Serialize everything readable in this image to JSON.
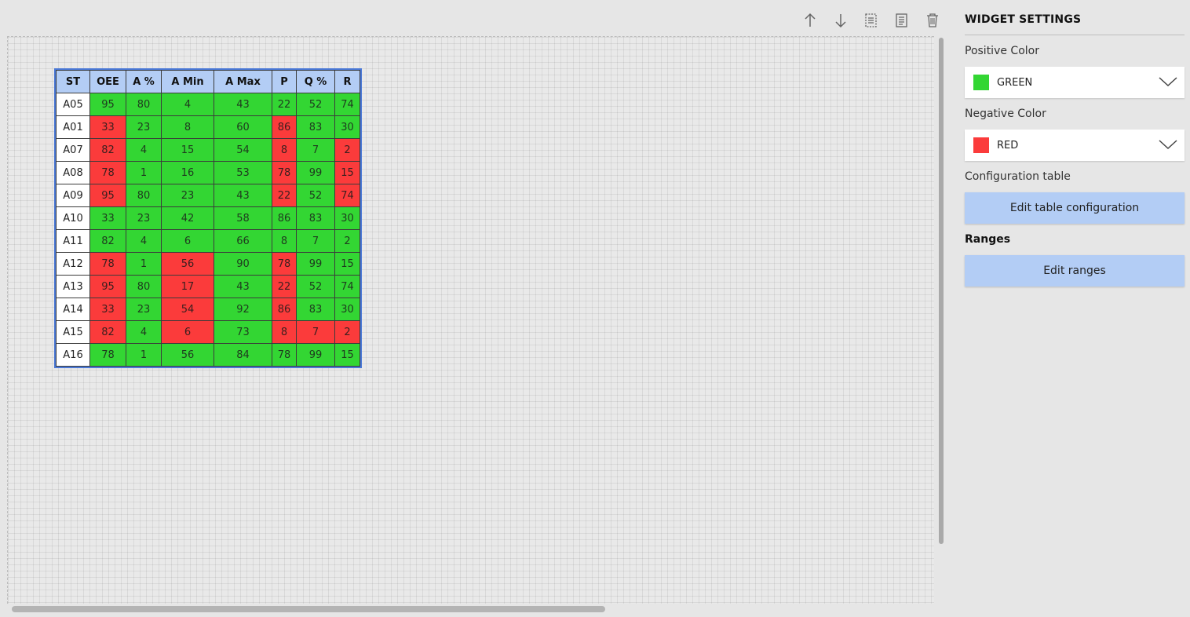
{
  "toolbar": {
    "icons": [
      "arrow-up-icon",
      "arrow-down-icon",
      "copy-widget-icon",
      "document-icon",
      "trash-icon"
    ]
  },
  "table": {
    "headers": [
      "ST",
      "OEE",
      "A %",
      "A Min",
      "A Max",
      "P",
      "Q %",
      "R"
    ],
    "rows": [
      {
        "cells": [
          "A05",
          "95",
          "80",
          "4",
          "43",
          "22",
          "52",
          "74"
        ],
        "status": [
          "st",
          "pos",
          "pos",
          "pos",
          "pos",
          "pos",
          "pos",
          "pos"
        ]
      },
      {
        "cells": [
          "A01",
          "33",
          "23",
          "8",
          "60",
          "86",
          "83",
          "30"
        ],
        "status": [
          "st",
          "neg",
          "pos",
          "pos",
          "pos",
          "neg",
          "pos",
          "pos"
        ]
      },
      {
        "cells": [
          "A07",
          "82",
          "4",
          "15",
          "54",
          "8",
          "7",
          "2"
        ],
        "status": [
          "st",
          "neg",
          "pos",
          "pos",
          "pos",
          "neg",
          "pos",
          "neg"
        ]
      },
      {
        "cells": [
          "A08",
          "78",
          "1",
          "16",
          "53",
          "78",
          "99",
          "15"
        ],
        "status": [
          "st",
          "neg",
          "pos",
          "pos",
          "pos",
          "neg",
          "pos",
          "neg"
        ]
      },
      {
        "cells": [
          "A09",
          "95",
          "80",
          "23",
          "43",
          "22",
          "52",
          "74"
        ],
        "status": [
          "st",
          "neg",
          "pos",
          "pos",
          "pos",
          "neg",
          "pos",
          "neg"
        ]
      },
      {
        "cells": [
          "A10",
          "33",
          "23",
          "42",
          "58",
          "86",
          "83",
          "30"
        ],
        "status": [
          "st",
          "pos",
          "pos",
          "pos",
          "pos",
          "pos",
          "pos",
          "pos"
        ]
      },
      {
        "cells": [
          "A11",
          "82",
          "4",
          "6",
          "66",
          "8",
          "7",
          "2"
        ],
        "status": [
          "st",
          "pos",
          "pos",
          "pos",
          "pos",
          "pos",
          "pos",
          "pos"
        ]
      },
      {
        "cells": [
          "A12",
          "78",
          "1",
          "56",
          "90",
          "78",
          "99",
          "15"
        ],
        "status": [
          "st",
          "neg",
          "pos",
          "neg",
          "pos",
          "neg",
          "pos",
          "pos"
        ]
      },
      {
        "cells": [
          "A13",
          "95",
          "80",
          "17",
          "43",
          "22",
          "52",
          "74"
        ],
        "status": [
          "st",
          "neg",
          "pos",
          "neg",
          "pos",
          "neg",
          "pos",
          "pos"
        ]
      },
      {
        "cells": [
          "A14",
          "33",
          "23",
          "54",
          "92",
          "86",
          "83",
          "30"
        ],
        "status": [
          "st",
          "neg",
          "pos",
          "neg",
          "pos",
          "neg",
          "pos",
          "pos"
        ]
      },
      {
        "cells": [
          "A15",
          "82",
          "4",
          "6",
          "73",
          "8",
          "7",
          "2"
        ],
        "status": [
          "st",
          "neg",
          "pos",
          "neg",
          "pos",
          "neg",
          "neg",
          "neg"
        ]
      },
      {
        "cells": [
          "A16",
          "78",
          "1",
          "56",
          "84",
          "78",
          "99",
          "15"
        ],
        "status": [
          "st",
          "pos",
          "pos",
          "pos",
          "pos",
          "pos",
          "pos",
          "pos"
        ]
      }
    ]
  },
  "settings": {
    "title": "WIDGET SETTINGS",
    "positive_label": "Positive Color",
    "positive_value": "GREEN",
    "positive_color": "#33d633",
    "negative_label": "Negative Color",
    "negative_value": "RED",
    "negative_color": "#fb3b3b",
    "config_label": "Configuration table",
    "config_button": "Edit table configuration",
    "ranges_label": "Ranges",
    "ranges_button": "Edit ranges"
  },
  "colors": {
    "header_bg": "#b3cdf5",
    "button_bg": "#b3cdf5",
    "widget_border": "#4a78d6"
  }
}
